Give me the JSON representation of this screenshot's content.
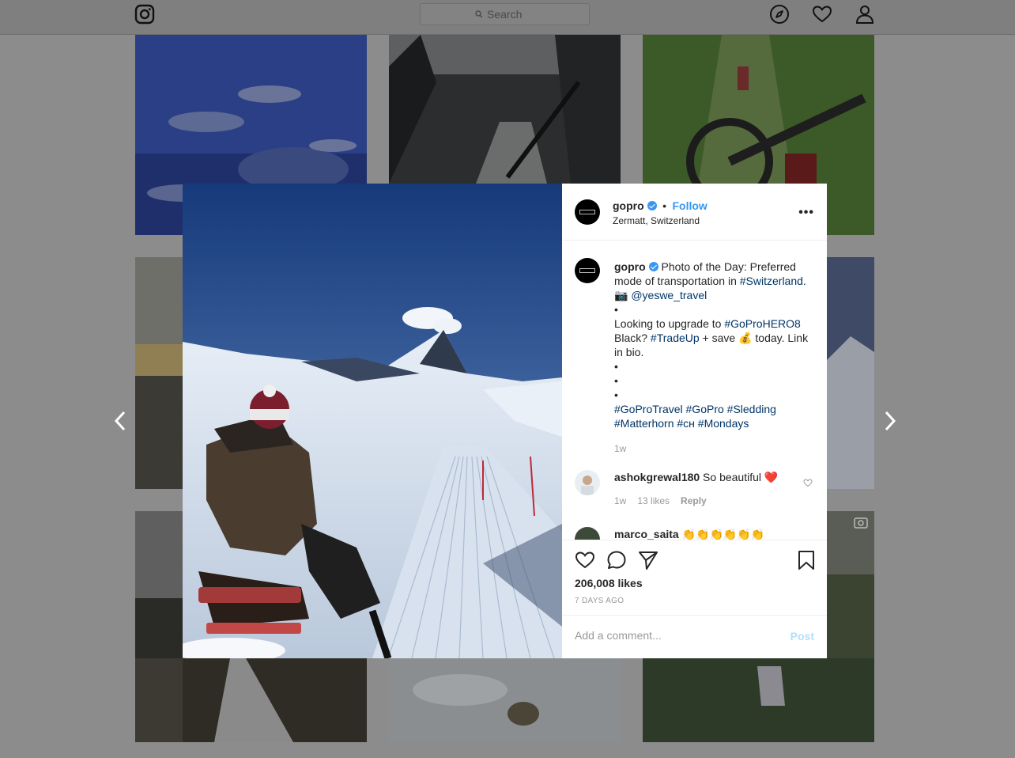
{
  "topbar": {
    "logo_icon": "instagram-logo-icon",
    "search_placeholder": "Search",
    "icons": [
      "compass-icon",
      "heart-icon",
      "user-icon"
    ]
  },
  "post": {
    "username": "gopro",
    "follow_label": "Follow",
    "separator": "•",
    "location": "Zermatt, Switzerland",
    "more_label": "•••",
    "caption": {
      "username": "gopro",
      "line1_text": " Photo of the Day: Preferred mode of transportation in ",
      "line1_tag": "#Switzerland.",
      "camera_emoji": " 📷 ",
      "mention": "@yeswe_travel",
      "bullet": "•",
      "upgrade_text_a": "Looking to upgrade to ",
      "upgrade_tag_a": "#GoProHERO8",
      "upgrade_text_b": "Black? ",
      "upgrade_tag_b": "#TradeUp",
      "upgrade_text_c": " + save 💰 today. Link in bio.",
      "hashtags": "#GoProTravel #GoPro #Sledding #Matterhorn #ᴄʜ #Mondays",
      "time": "1w"
    },
    "comments": [
      {
        "username": "ashokgrewal180",
        "text": " So beautiful ❤️",
        "time": "1w",
        "likes": "13 likes",
        "reply": "Reply"
      },
      {
        "username": "marco_saita",
        "text": " 👏👏👏👏👏👏"
      }
    ],
    "likes": "206,008 likes",
    "posted_ago": "7 DAYS AGO",
    "add_comment_placeholder": "Add a comment...",
    "post_label": "Post"
  },
  "colors": {
    "accent": "#3897f0",
    "hashtag": "#003569",
    "overlay": "#8c8c8c"
  }
}
